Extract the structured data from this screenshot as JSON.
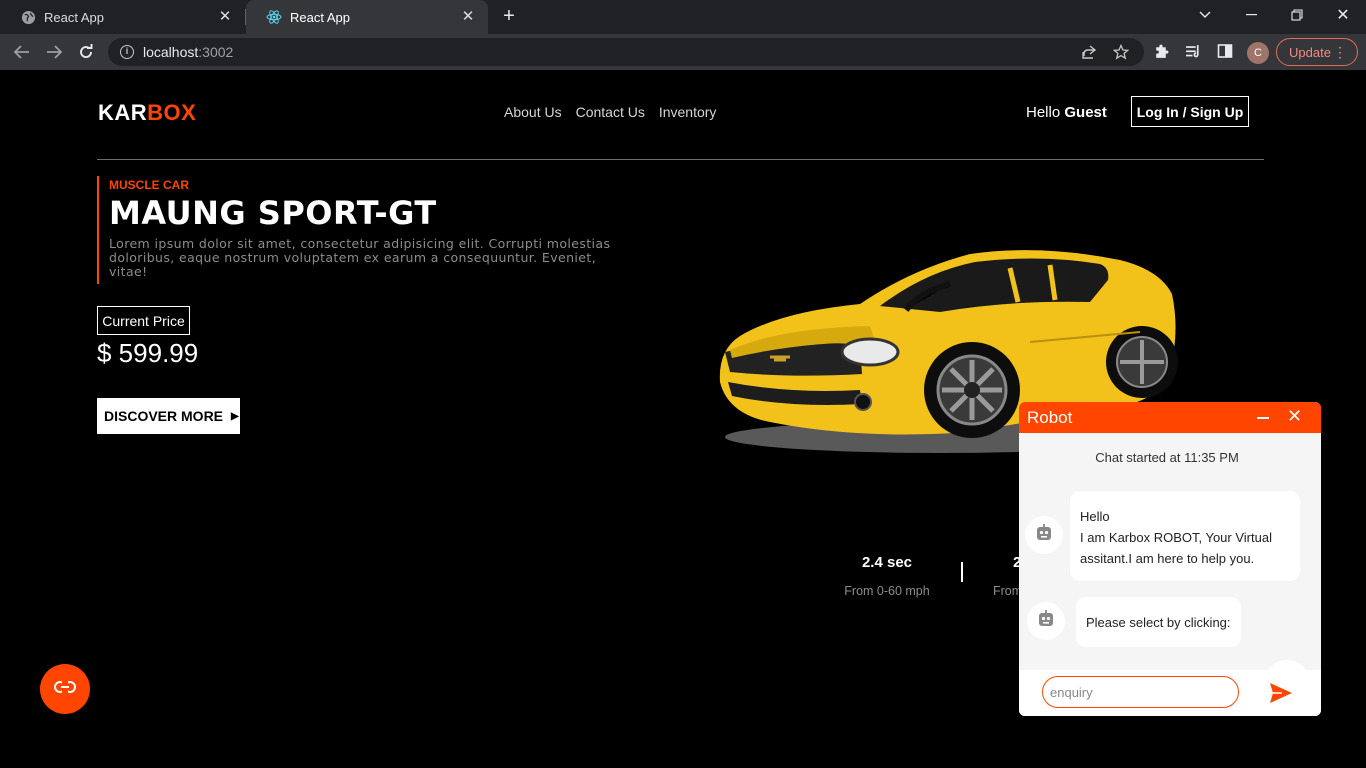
{
  "browser": {
    "tabs": [
      {
        "title": "React App",
        "active": false
      },
      {
        "title": "React App",
        "active": true
      }
    ],
    "url_host": "localhost",
    "url_port": ":3002",
    "update_label": "Update",
    "profile_initial": "C"
  },
  "header": {
    "logo_part1": "KAR",
    "logo_part2": "BOX",
    "nav": [
      "About Us",
      "Contact Us",
      "Inventory"
    ],
    "greeting": "Hello",
    "user": "Guest",
    "login_label": "Log In / Sign Up"
  },
  "hero": {
    "category": "MUSCLE CAR",
    "model": "MAUNG SPORT-GT",
    "description": "Lorem ipsum dolor sit amet, consectetur adipisicing elit. Corrupti molestias doloribus, eaque nostrum voluptatem ex earum a consequuntur. Eveniet, vitae!",
    "price_label": "Current Price",
    "price": "$ 599.99",
    "cta_label": "DISCOVER MORE"
  },
  "stats": [
    {
      "value": "2.4 sec",
      "label": "From 0-60 mph"
    },
    {
      "value": "2",
      "label": "From"
    }
  ],
  "chat": {
    "title": "Robot",
    "started": "Chat started at 11:35 PM",
    "messages": [
      {
        "line1": "Hello",
        "line2": "I am Karbox ROBOT, Your Virtual",
        "line3": "assitant.I am here to help you."
      },
      {
        "line1": "Please select by clicking:"
      }
    ],
    "input_placeholder": "enquiry"
  },
  "colors": {
    "accent": "#ff4500",
    "background": "#000000",
    "car": "#f5c518"
  }
}
